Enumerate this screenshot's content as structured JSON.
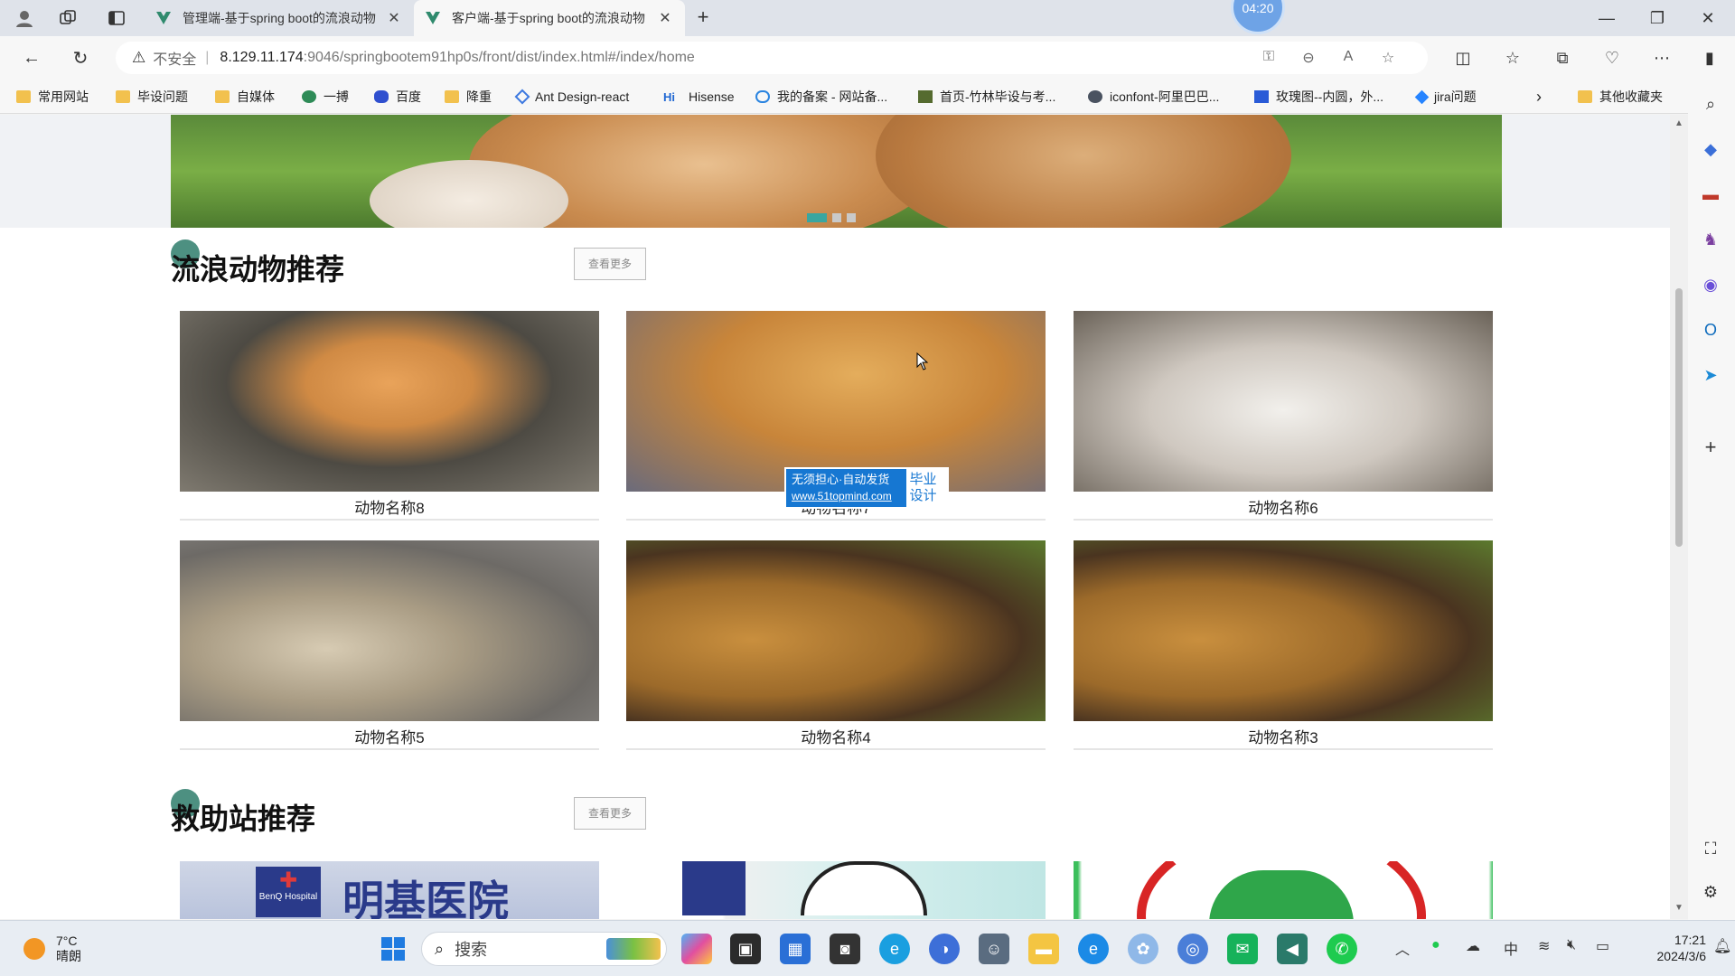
{
  "browser": {
    "tabs": [
      {
        "title": "管理端-基于spring boot的流浪动物",
        "active": false
      },
      {
        "title": "客户端-基于spring boot的流浪动物",
        "active": true
      }
    ],
    "timer": "04:20",
    "address": {
      "security_label": "不安全",
      "host": "8.129.11.174",
      "path": ":9046/springbootem91hp0s/front/dist/index.html#/index/home"
    },
    "bookmarks": [
      {
        "label": "常用网站",
        "icon": "folder-icon"
      },
      {
        "label": "毕设问题",
        "icon": "folder-icon"
      },
      {
        "label": "自媒体",
        "icon": "folder-icon"
      },
      {
        "label": "一搏",
        "icon": "leaf-icon"
      },
      {
        "label": "百度",
        "icon": "baidu-paw-icon"
      },
      {
        "label": "降重",
        "icon": "folder-icon"
      },
      {
        "label": "Ant Design-react",
        "icon": "ant-design-icon"
      },
      {
        "label": "Hisense",
        "icon": "hisense-icon"
      },
      {
        "label": "我的备案 - 网站备...",
        "icon": "cloud-icon"
      },
      {
        "label": "首页-竹林毕设与考...",
        "icon": "bamboo-icon"
      },
      {
        "label": "iconfont-阿里巴巴...",
        "icon": "iconfont-icon"
      },
      {
        "label": "玫瑰图--内圆，外...",
        "icon": "chart-icon"
      },
      {
        "label": "jira问题",
        "icon": "jira-icon"
      }
    ],
    "other_bookmarks": "其他收藏夹"
  },
  "page": {
    "animals_section": {
      "title": "流浪动物推荐",
      "more_label": "查看更多",
      "cards": [
        {
          "name": "动物名称8",
          "photo": "shiba"
        },
        {
          "name": "动物名称7",
          "photo": "golden"
        },
        {
          "name": "动物名称6",
          "photo": "kitten"
        },
        {
          "name": "动物名称5",
          "photo": "duck"
        },
        {
          "name": "动物名称4",
          "photo": "lion"
        },
        {
          "name": "动物名称3",
          "photo": "lion"
        }
      ]
    },
    "stations_section": {
      "title": "救助站推荐",
      "more_label": "查看更多",
      "hospital_sign": "明基医院",
      "hospital_logo_text": "BenQ Hospital"
    },
    "watermark": {
      "line1": "无须担心·自动发货",
      "line2": "www.51topmind.com",
      "side": "毕业设计"
    }
  },
  "taskbar": {
    "weather_temp": "7°C",
    "weather_desc": "晴朗",
    "search_placeholder": "搜索",
    "tray_ime": "中",
    "time": "17:21",
    "date": "2024/3/6"
  }
}
